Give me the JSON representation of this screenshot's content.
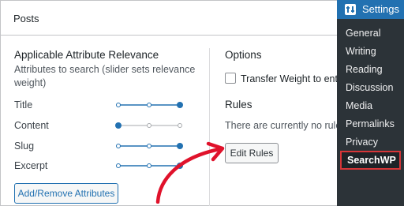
{
  "panel": {
    "title": "Posts"
  },
  "attributes": {
    "title": "Applicable Attribute Relevance",
    "description_line1": "Attributes to search (slider sets relevance",
    "description_line2": "weight)",
    "items": [
      {
        "label": "Title",
        "level": 1.0
      },
      {
        "label": "Content",
        "level": 0.0
      },
      {
        "label": "Slug",
        "level": 1.0
      },
      {
        "label": "Excerpt",
        "level": 1.0
      }
    ],
    "add_remove_label": "Add/Remove Attributes"
  },
  "options": {
    "title": "Options",
    "transfer_weight_label": "Transfer Weight to entry I",
    "transfer_weight_checked": false
  },
  "rules": {
    "title": "Rules",
    "empty_text": "There are currently no rules f",
    "edit_label": "Edit Rules"
  },
  "menu": {
    "header": "Settings",
    "items": [
      "General",
      "Writing",
      "Reading",
      "Discussion",
      "Media",
      "Permalinks",
      "Privacy",
      "SearchWP"
    ]
  },
  "colors": {
    "accent": "#2271b1",
    "menu_bg": "#2c3338",
    "highlight": "#d63638",
    "annotation_arrow": "#e0122b",
    "slider_inactive": "#a7aaad"
  }
}
